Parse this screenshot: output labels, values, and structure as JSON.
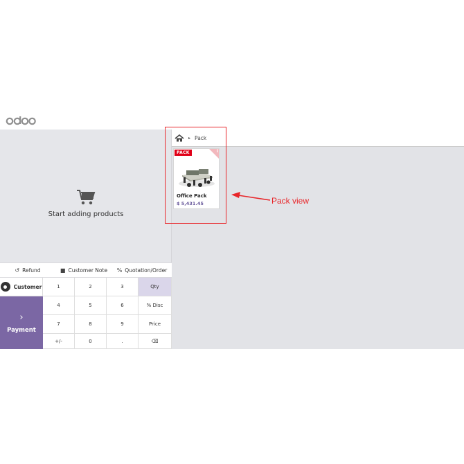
{
  "brand": {
    "logo_text": "odoo"
  },
  "products_panel": {
    "empty_message": "Start adding products"
  },
  "actions": [
    {
      "icon": "undo-icon",
      "glyph": "↺",
      "label": "Refund"
    },
    {
      "icon": "note-icon",
      "glyph": "■",
      "label": "Customer Note"
    },
    {
      "icon": "percent-icon",
      "glyph": "%",
      "label": "Quotation/Order"
    }
  ],
  "pad": {
    "customer_label": "Customer",
    "payment_label": "Payment",
    "payment_arrow": "›",
    "keys": [
      "1",
      "2",
      "3",
      "Qty",
      "4",
      "5",
      "6",
      "% Disc",
      "7",
      "8",
      "9",
      "Price",
      "+/-",
      "0",
      ".",
      "⌫"
    ],
    "active_mode": "Qty"
  },
  "breadcrumb": {
    "home_icon": "home-icon",
    "separator": "▸",
    "current": "Pack"
  },
  "product": {
    "badge": "PACK",
    "info_icon": "i",
    "name": "Office Pack",
    "price": "$ 5,431.45"
  },
  "annotation": {
    "text": "Pack view",
    "color": "#e8262a"
  },
  "colors": {
    "payment_bg": "#7b67a4",
    "active_key_bg": "#dad6ea",
    "badge_red": "#e00018",
    "price_purple": "#6a5a9c"
  }
}
